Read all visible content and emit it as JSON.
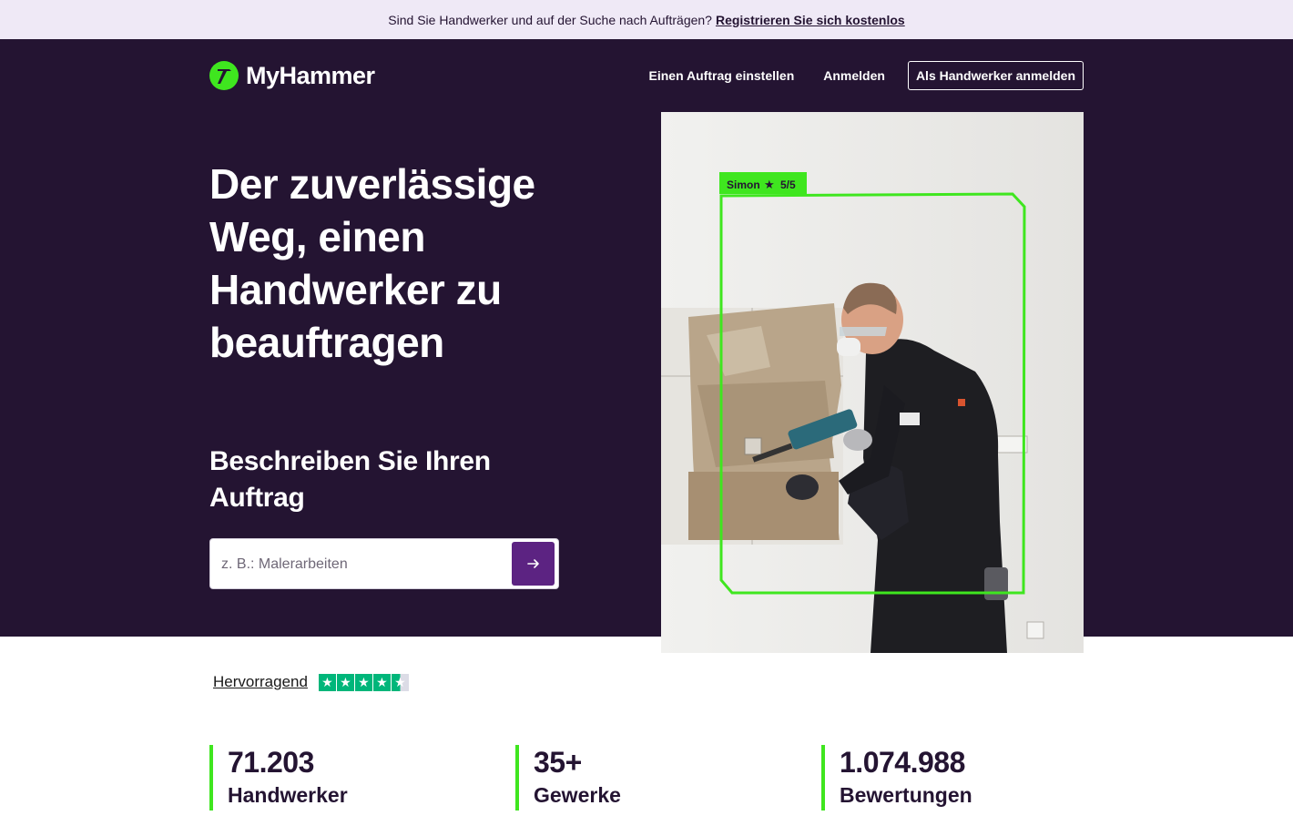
{
  "topbar": {
    "text": "Sind Sie Handwerker und auf der Suche nach Aufträgen?",
    "link": "Registrieren Sie sich kostenlos"
  },
  "brand": {
    "name": "MyHammer",
    "accent": "#3fe61f",
    "background": "#241432"
  },
  "nav": {
    "post_job": "Einen Auftrag einstellen",
    "login": "Anmelden",
    "tradesman_login": "Als Handwerker anmelden"
  },
  "hero": {
    "headline": "Der zuverlässige Weg, einen Handwerker zu beauftragen",
    "subheadline": "Beschreiben Sie Ihren Auftrag",
    "search_placeholder": "z. B.: Malerarbeiten",
    "search_value": "",
    "submit_icon": "arrow-right-icon",
    "photo_tag": {
      "name": "Simon",
      "rating": "5/5"
    }
  },
  "rating": {
    "label": "Hervorragend",
    "stars": 4.5,
    "max_stars": 5
  },
  "stats": [
    {
      "value": "71.203",
      "label": "Handwerker"
    },
    {
      "value": "35+",
      "label": "Gewerke"
    },
    {
      "value": "1.074.988",
      "label": "Bewertungen"
    }
  ]
}
